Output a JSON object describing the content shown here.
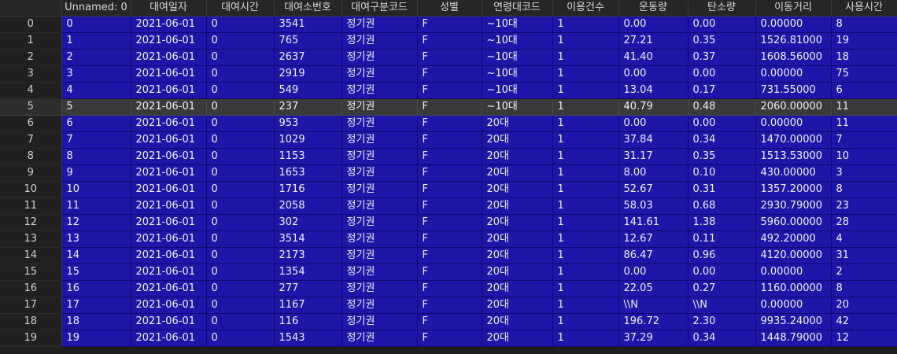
{
  "columns": [
    "",
    "Unnamed: 0",
    "대여일자",
    "대여시간",
    "대여소번호",
    "대여구분코드",
    "성별",
    "연령대코드",
    "이용건수",
    "운동량",
    "탄소량",
    "이동거리",
    "사용시간"
  ],
  "selected_row": 5,
  "colors": {
    "cell_bg": "#1c17a8",
    "selected_bg": "#3a3a3a",
    "header_bg": "#262626"
  },
  "rows": [
    [
      "0",
      "0",
      "2021-06-01",
      "0",
      "3541",
      "정기권",
      "F",
      "~10대",
      "1",
      "0.00",
      "0.00",
      "0.00000",
      "8"
    ],
    [
      "1",
      "1",
      "2021-06-01",
      "0",
      "765",
      "정기권",
      "F",
      "~10대",
      "1",
      "27.21",
      "0.35",
      "1526.81000",
      "19"
    ],
    [
      "2",
      "2",
      "2021-06-01",
      "0",
      "2637",
      "정기권",
      "F",
      "~10대",
      "1",
      "41.40",
      "0.37",
      "1608.56000",
      "18"
    ],
    [
      "3",
      "3",
      "2021-06-01",
      "0",
      "2919",
      "정기권",
      "F",
      "~10대",
      "1",
      "0.00",
      "0.00",
      "0.00000",
      "75"
    ],
    [
      "4",
      "4",
      "2021-06-01",
      "0",
      "549",
      "정기권",
      "F",
      "~10대",
      "1",
      "13.04",
      "0.17",
      "731.55000",
      "6"
    ],
    [
      "5",
      "5",
      "2021-06-01",
      "0",
      "237",
      "정기권",
      "F",
      "~10대",
      "1",
      "40.79",
      "0.48",
      "2060.00000",
      "11"
    ],
    [
      "6",
      "6",
      "2021-06-01",
      "0",
      "953",
      "정기권",
      "F",
      "20대",
      "1",
      "0.00",
      "0.00",
      "0.00000",
      "11"
    ],
    [
      "7",
      "7",
      "2021-06-01",
      "0",
      "1029",
      "정기권",
      "F",
      "20대",
      "1",
      "37.84",
      "0.34",
      "1470.00000",
      "7"
    ],
    [
      "8",
      "8",
      "2021-06-01",
      "0",
      "1153",
      "정기권",
      "F",
      "20대",
      "1",
      "31.17",
      "0.35",
      "1513.53000",
      "10"
    ],
    [
      "9",
      "9",
      "2021-06-01",
      "0",
      "1653",
      "정기권",
      "F",
      "20대",
      "1",
      "8.00",
      "0.10",
      "430.00000",
      "3"
    ],
    [
      "10",
      "10",
      "2021-06-01",
      "0",
      "1716",
      "정기권",
      "F",
      "20대",
      "1",
      "52.67",
      "0.31",
      "1357.20000",
      "8"
    ],
    [
      "11",
      "11",
      "2021-06-01",
      "0",
      "2058",
      "정기권",
      "F",
      "20대",
      "1",
      "58.03",
      "0.68",
      "2930.79000",
      "23"
    ],
    [
      "12",
      "12",
      "2021-06-01",
      "0",
      "302",
      "정기권",
      "F",
      "20대",
      "1",
      "141.61",
      "1.38",
      "5960.00000",
      "28"
    ],
    [
      "13",
      "13",
      "2021-06-01",
      "0",
      "3514",
      "정기권",
      "F",
      "20대",
      "1",
      "12.67",
      "0.11",
      "492.20000",
      "4"
    ],
    [
      "14",
      "14",
      "2021-06-01",
      "0",
      "2173",
      "정기권",
      "F",
      "20대",
      "1",
      "86.47",
      "0.96",
      "4120.00000",
      "31"
    ],
    [
      "15",
      "15",
      "2021-06-01",
      "0",
      "1354",
      "정기권",
      "F",
      "20대",
      "1",
      "0.00",
      "0.00",
      "0.00000",
      "2"
    ],
    [
      "16",
      "16",
      "2021-06-01",
      "0",
      "277",
      "정기권",
      "F",
      "20대",
      "1",
      "22.05",
      "0.27",
      "1160.00000",
      "8"
    ],
    [
      "17",
      "17",
      "2021-06-01",
      "0",
      "1167",
      "정기권",
      "F",
      "20대",
      "1",
      "\\\\N",
      "\\\\N",
      "0.00000",
      "20"
    ],
    [
      "18",
      "18",
      "2021-06-01",
      "0",
      "116",
      "정기권",
      "F",
      "20대",
      "1",
      "196.72",
      "2.30",
      "9935.24000",
      "42"
    ],
    [
      "19",
      "19",
      "2021-06-01",
      "0",
      "1543",
      "정기권",
      "F",
      "20대",
      "1",
      "37.29",
      "0.34",
      "1448.79000",
      "12"
    ]
  ]
}
